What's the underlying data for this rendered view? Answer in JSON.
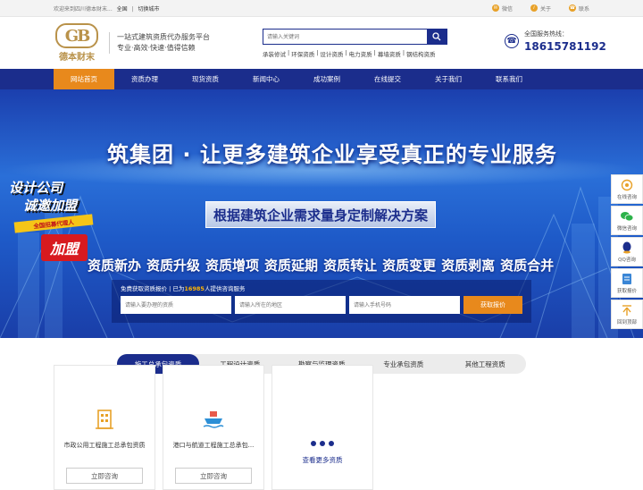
{
  "topbar": {
    "welcome": "欢迎来到四川德本财末...",
    "region": "全国",
    "switch_city": "切换城市",
    "links": [
      {
        "label": "微信",
        "icon": "wechat-icon"
      },
      {
        "label": "关于",
        "icon": "info-icon"
      },
      {
        "label": "联系",
        "icon": "phone-icon"
      }
    ]
  },
  "header": {
    "logo_mark": "GB",
    "logo_name": "德本财末",
    "slogan_line1": "一站式建筑资质代办服务平台",
    "slogan_line2": "专业·高效·快速·值得信赖",
    "search_placeholder": "请输入关键词",
    "quicklinks": [
      "承装修试",
      "环保资质",
      "设计资质",
      "电力资质",
      "幕墙资质",
      "钢结构资质"
    ],
    "hotline_label": "全国服务热线：",
    "hotline_number": "18615781192"
  },
  "nav": {
    "items": [
      "网站首页",
      "资质办理",
      "现货资质",
      "新闻中心",
      "成功案例",
      "在线提交",
      "关于我们",
      "联系我们"
    ],
    "active_index": 0
  },
  "banner": {
    "headline": "筑集团 · 让更多建筑企业享受真正的专业服务",
    "ribbon": "根据建筑企业需求量身定制解决方案",
    "tags": [
      "资质新办",
      "资质升级",
      "资质增项",
      "资质延期",
      "资质转让",
      "资质变更",
      "资质剥离",
      "资质合并"
    ],
    "form": {
      "title_prefix": "免费获取资质报价 | 已为",
      "count": "16985",
      "title_suffix": "人提供咨询服务",
      "placeholder_qual": "请输入要办理的资质",
      "placeholder_region": "请输入所在的地区",
      "placeholder_phone": "请输入手机号码",
      "submit_label": "获取报价"
    },
    "promo": {
      "line1": "设计公司",
      "line2": "诚邀加盟",
      "bar": "全国招募代理人",
      "join": "加盟"
    }
  },
  "tabs": {
    "items": [
      "施工总承包资质",
      "工程设计资质",
      "勘察与监理资质",
      "专业承包资质",
      "其他工程资质"
    ],
    "active_index": 0
  },
  "cards": [
    {
      "title": "市政公用工程施工总承包资质",
      "button": "立即咨询",
      "icon": "building-icon"
    },
    {
      "title": "港口与航道工程施工总承包...",
      "button": "立即咨询",
      "icon": "ship-icon"
    }
  ],
  "more_card": {
    "label": "查看更多资质"
  },
  "sidepanel": [
    {
      "label": "在线咨询",
      "icon": "chat-icon"
    },
    {
      "label": "微信咨询",
      "icon": "wechat-icon"
    },
    {
      "label": "QQ咨询",
      "icon": "qq-icon"
    },
    {
      "label": "获取报价",
      "icon": "quote-icon"
    },
    {
      "label": "回到顶部",
      "icon": "back-to-top-icon"
    }
  ],
  "colors": {
    "brand_blue": "#1b2d8c",
    "accent_orange": "#e8891c",
    "gold": "#b9924a"
  }
}
